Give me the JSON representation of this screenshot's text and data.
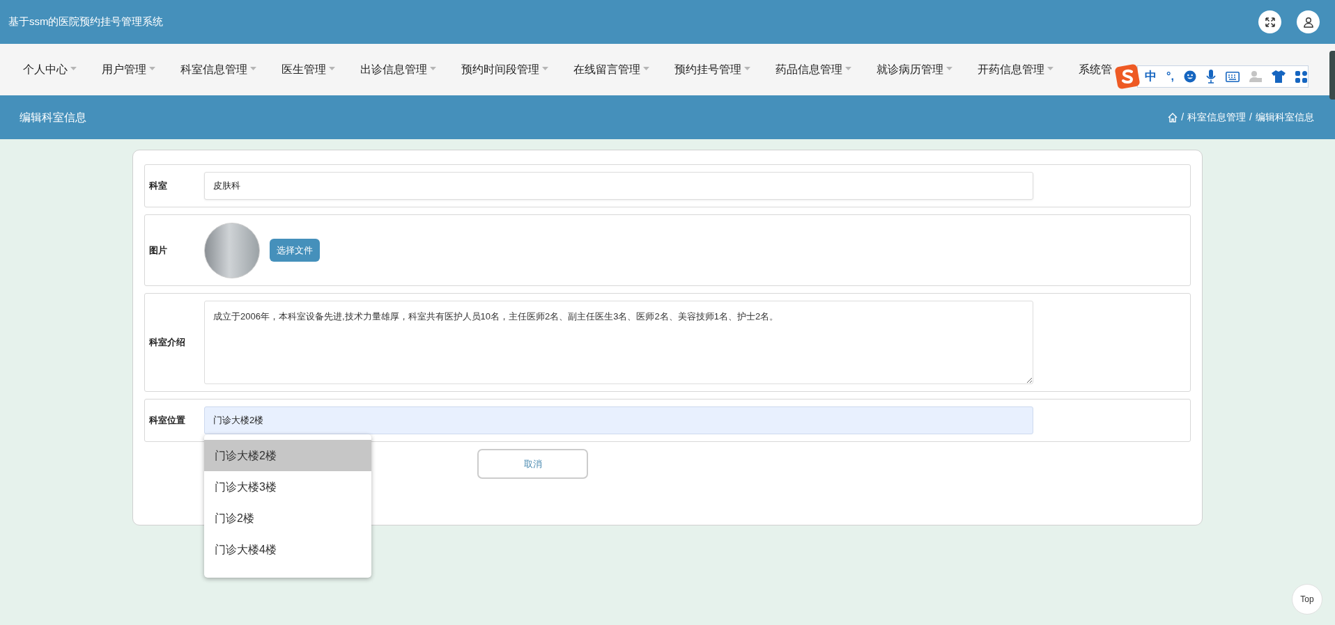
{
  "header": {
    "title": "基于ssm的医院预约挂号管理系统"
  },
  "nav": [
    {
      "label": "个人中心",
      "caret": true
    },
    {
      "label": "用户管理",
      "caret": true
    },
    {
      "label": "科室信息管理",
      "caret": true
    },
    {
      "label": "医生管理",
      "caret": true
    },
    {
      "label": "出诊信息管理",
      "caret": true
    },
    {
      "label": "预约时间段管理",
      "caret": true
    },
    {
      "label": "在线留言管理",
      "caret": true
    },
    {
      "label": "预约挂号管理",
      "caret": true
    },
    {
      "label": "药品信息管理",
      "caret": true
    },
    {
      "label": "就诊病历管理",
      "caret": true
    },
    {
      "label": "开药信息管理",
      "caret": true
    },
    {
      "label": "系统管",
      "caret": false
    }
  ],
  "ime_toolbar": {
    "mode": "中",
    "punctuation": "°,"
  },
  "page_header": {
    "title": "编辑科室信息",
    "separator": "/",
    "breadcrumb": [
      "科室信息管理",
      "编辑科室信息"
    ]
  },
  "form": {
    "fields": [
      {
        "kind": "text",
        "label": "科室",
        "value": "皮肤科",
        "focused": false
      },
      {
        "kind": "image",
        "label": "图片",
        "button": "选择文件"
      },
      {
        "kind": "textarea",
        "label": "科室介绍",
        "value": "成立于2006年，本科室设备先进,技术力量雄厚，科室共有医护人员10名，主任医师2名、副主任医生3名、医师2名、美容技师1名、护士2名。"
      },
      {
        "kind": "text",
        "label": "科室位置",
        "value": "门诊大楼2楼",
        "focused": true
      }
    ],
    "cancel_button": "取消",
    "dropdown": [
      {
        "label": "门诊大楼2楼",
        "selected": true
      },
      {
        "label": "门诊大楼3楼",
        "selected": false
      },
      {
        "label": "门诊2楼",
        "selected": false
      },
      {
        "label": "门诊大楼4楼",
        "selected": false
      }
    ]
  },
  "top_button": "Top"
}
